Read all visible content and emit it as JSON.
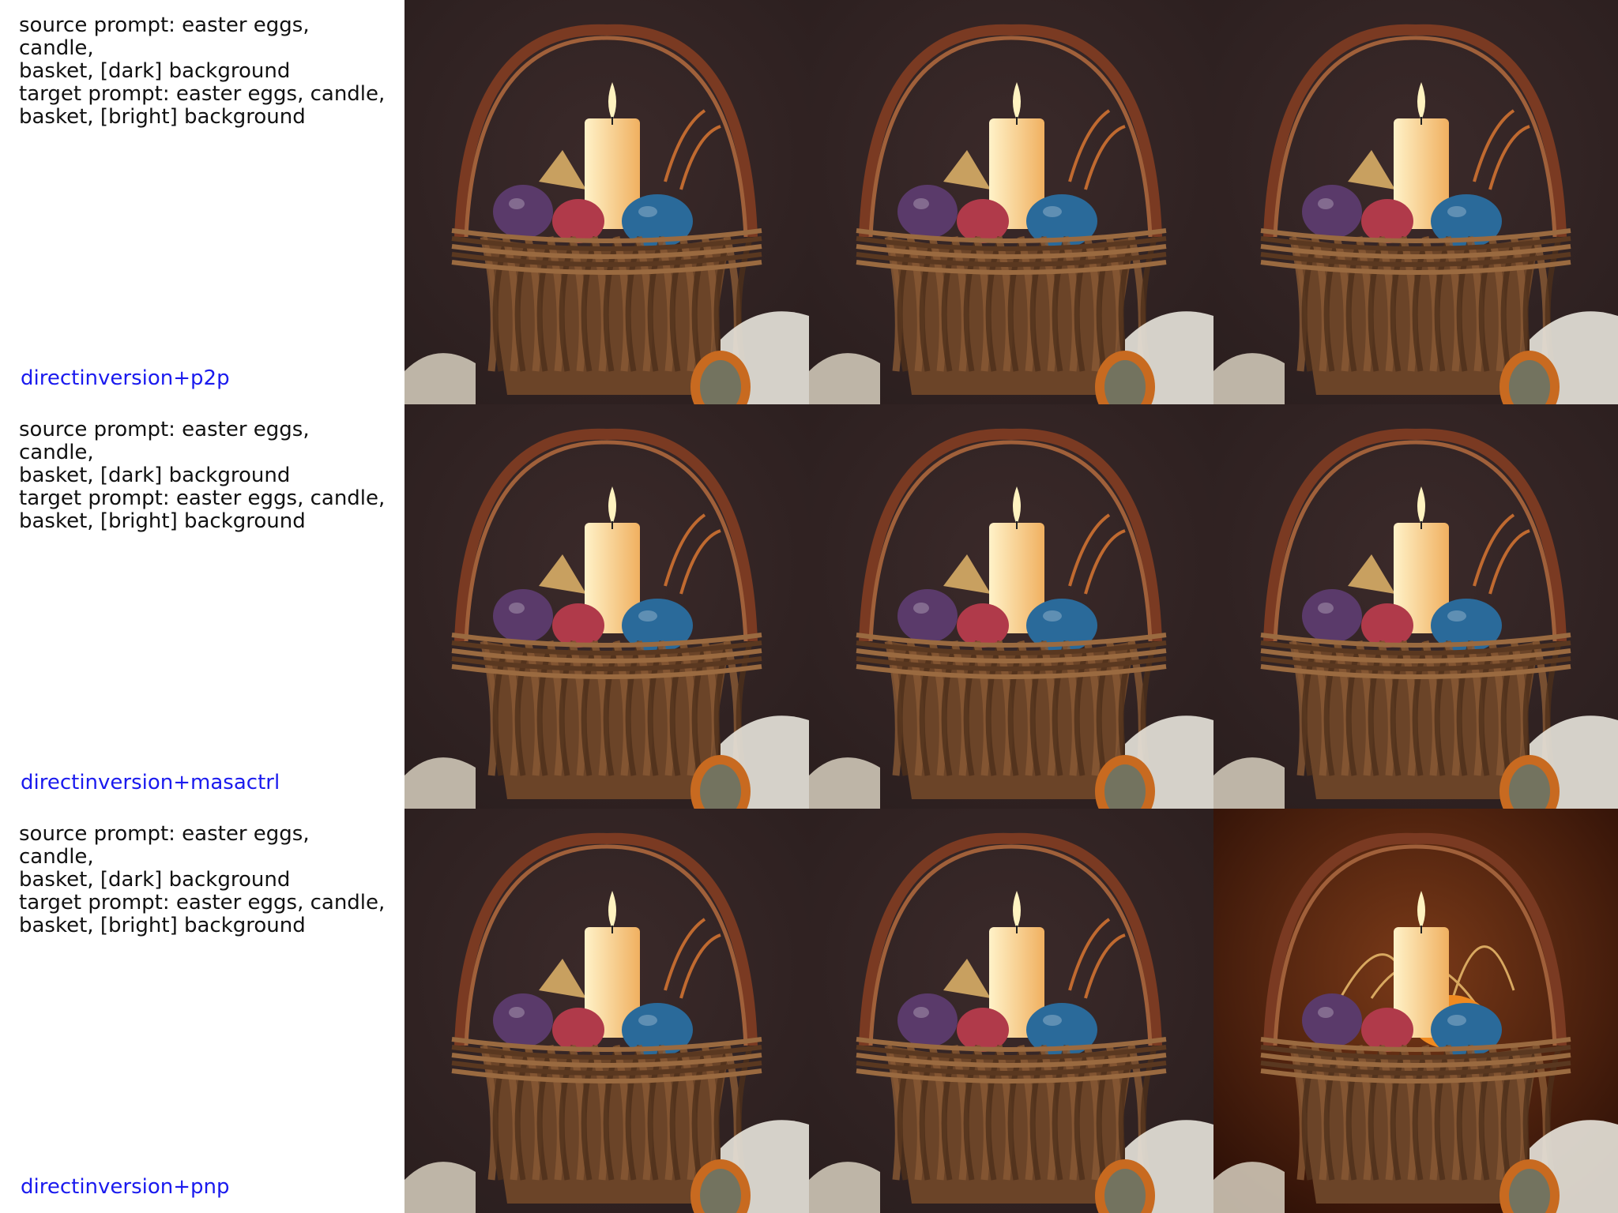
{
  "rows": [
    {
      "prompt": "source prompt: easter eggs, candle,\nbasket, [dark] background\ntarget prompt: easter eggs, candle,\nbasket, [bright] background",
      "method": "directinversion+p2p"
    },
    {
      "prompt": "source prompt: easter eggs, candle,\nbasket, [dark] background\ntarget prompt: easter eggs, candle,\nbasket, [bright] background",
      "method": "directinversion+masactrl"
    },
    {
      "prompt": "source prompt: easter eggs, candle,\nbasket, [dark] background\ntarget prompt: easter eggs, candle,\nbasket, [bright] background",
      "method": "directinversion+pnp"
    }
  ],
  "colors": {
    "method_label": "#1a1aee",
    "prompt_text": "#111111",
    "background_dark": "#2a1e1e",
    "background_warm": "#4a2414",
    "basket": "#6b4428",
    "candle": "#f0b060",
    "flame": "#fff3c0",
    "egg_purple": "#5a3a6a",
    "egg_red": "#b03a4a",
    "egg_blue": "#2a6a9a"
  }
}
